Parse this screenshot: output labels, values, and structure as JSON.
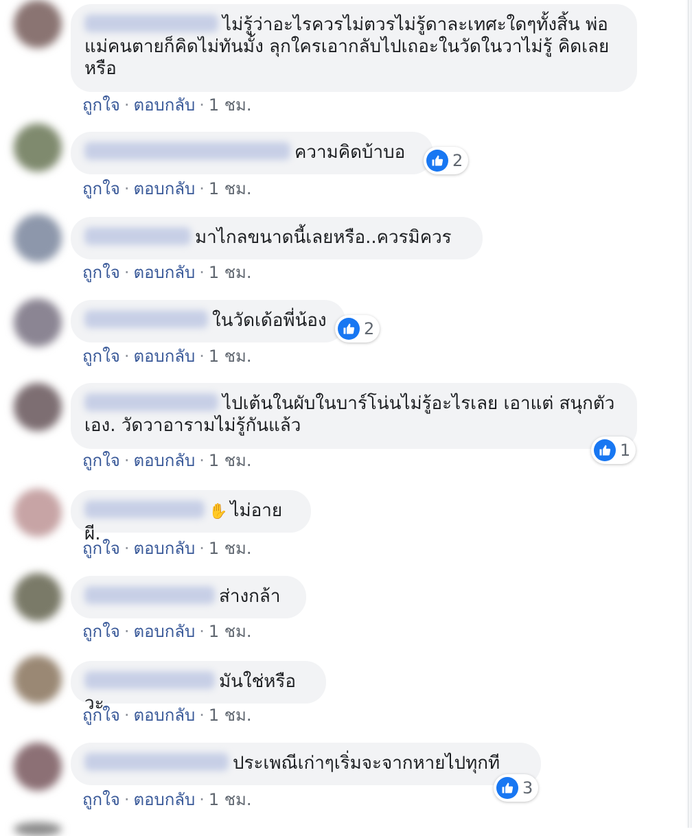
{
  "comments": [
    {
      "text": "ไม่รู้ว่าอะไรควรไม่ตวรไม่รู้ดาละเทศะใดๆทั้งสิ้น พ่อแม่คนตายก็คิดไม่ทันมั้ง ลุกใครเอากลับไปเถอะในวัดในวาไม่รู้ คิดเลยหรือ",
      "like": "ถูกใจ",
      "reply": "ตอบกลับ",
      "time": "1 ชม.",
      "reactions": null
    },
    {
      "text": "ความคิดบ้าบอ",
      "like": "ถูกใจ",
      "reply": "ตอบกลับ",
      "time": "1 ชม.",
      "reactions": "2"
    },
    {
      "text": "มาไกลขนาดนี้เลยหรือ..ควรมิควร",
      "like": "ถูกใจ",
      "reply": "ตอบกลับ",
      "time": "1 ชม.",
      "reactions": null
    },
    {
      "text": "ในวัดเด้อพี่น้อง",
      "like": "ถูกใจ",
      "reply": "ตอบกลับ",
      "time": "1 ชม.",
      "reactions": "2"
    },
    {
      "text": "ไปเต้นในผับในบาร์โน่นไม่รู้อะไรเลย เอาแต่ สนุกตัวเอง. วัดวาอารามไม่รู้กันแล้ว",
      "like": "ถูกใจ",
      "reply": "ตอบกลับ",
      "time": "1 ชม.",
      "reactions": "1"
    },
    {
      "text": "ไม่อายผี.",
      "like": "ถูกใจ",
      "reply": "ตอบกลับ",
      "time": "1 ชม.",
      "reactions": null
    },
    {
      "text": "ส่างกล้า",
      "like": "ถูกใจ",
      "reply": "ตอบกลับ",
      "time": "1 ชม.",
      "reactions": null
    },
    {
      "text": "มันใช่หรือวะ",
      "like": "ถูกใจ",
      "reply": "ตอบกลับ",
      "time": "1 ชม.",
      "reactions": null
    },
    {
      "text": "ประเพณีเก่าๆเริ่มจะจากหายไปทุกที",
      "like": "ถูกใจ",
      "reply": "ตอบกลับ",
      "time": "1 ชม.",
      "reactions": "3"
    }
  ],
  "separator": "·",
  "icons": {
    "like": "thumbs-up-icon",
    "wave": "waving-hand-icon"
  },
  "colors": {
    "accent": "#1877f2",
    "link": "#385898",
    "bubble": "#f2f3f5"
  }
}
